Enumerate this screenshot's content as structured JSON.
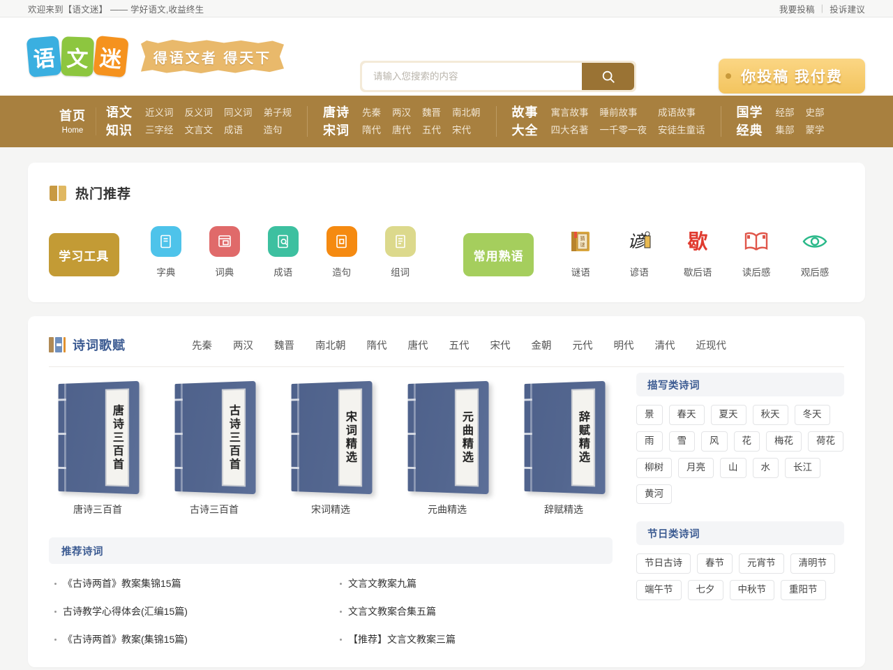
{
  "topbar": {
    "welcome": "欢迎来到【语文迷】 —— 学好语文,收益终生",
    "submit_link": "我要投稿",
    "separator": "|",
    "feedback_link": "投诉建议"
  },
  "header": {
    "logo_chars": [
      "语",
      "文",
      "迷"
    ],
    "slogan": "得语文者 得天下",
    "search": {
      "placeholder": "请输入您搜索的内容",
      "value": "",
      "button_icon": "search-icon"
    },
    "promo": "你投稿 我付费"
  },
  "nav": [
    {
      "title": "首页",
      "sub": "Home",
      "links": [],
      "cols": 1
    },
    {
      "title_l1": "语文",
      "title_l2": "知识",
      "cols": 4,
      "links": [
        "近义词",
        "反义词",
        "同义词",
        "弟子规",
        "三字经",
        "文言文",
        "成语",
        "造句"
      ]
    },
    {
      "title_l1": "唐诗",
      "title_l2": "宋词",
      "cols": 4,
      "links": [
        "先秦",
        "两汉",
        "魏晋",
        "南北朝",
        "隋代",
        "唐代",
        "五代",
        "宋代"
      ]
    },
    {
      "title_l1": "故事",
      "title_l2": "大全",
      "cols": 3,
      "links": [
        "寓言故事",
        "睡前故事",
        "成语故事",
        "四大名著",
        "一千零一夜",
        "安徒生童话"
      ]
    },
    {
      "title_l1": "国学",
      "title_l2": "经典",
      "cols": 2,
      "links": [
        "经部",
        "史部",
        "集部",
        "蒙学"
      ]
    }
  ],
  "hot": {
    "section_title": "热门推荐",
    "section_icon": "open-book-icon",
    "tools_button": "学习工具",
    "tools_color": "#c39b35",
    "idioms_button": "常用熟语",
    "idioms_color": "#a5ce5d",
    "tools_items": [
      {
        "label": "字典",
        "icon": "dictionary-icon",
        "glyph": "字",
        "color": "#4ec3ea"
      },
      {
        "label": "词典",
        "icon": "word-dictionary-icon",
        "glyph": "词",
        "color": "#e06a6a"
      },
      {
        "label": "成语",
        "icon": "idiom-search-icon",
        "glyph": "成",
        "color": "#3dc0a0"
      },
      {
        "label": "造句",
        "icon": "sentence-icon",
        "glyph": "句",
        "color": "#f58a11"
      },
      {
        "label": "组词",
        "icon": "word-group-icon",
        "glyph": "组",
        "color": "#dcd98c"
      }
    ],
    "idiom_items": [
      {
        "label": "谜语",
        "icon": "riddle-book-icon",
        "glyph": "谜",
        "color": "#c9962f"
      },
      {
        "label": "谚语",
        "icon": "proverb-icon",
        "glyph": "谚",
        "color": "#2b2b2b"
      },
      {
        "label": "歇后语",
        "icon": "xiehouyu-icon",
        "glyph": "歇",
        "color": "#e03b2f"
      },
      {
        "label": "读后感",
        "icon": "open-book-red-icon",
        "glyph": "",
        "color": "#e0564a"
      },
      {
        "label": "观后感",
        "icon": "eye-icon",
        "glyph": "",
        "color": "#2bb98a"
      }
    ]
  },
  "poetry": {
    "section_title": "诗词歌赋",
    "section_icon": "books-icon",
    "dynasties": [
      "先秦",
      "两汉",
      "魏晋",
      "南北朝",
      "隋代",
      "唐代",
      "五代",
      "宋代",
      "金朝",
      "元代",
      "明代",
      "清代",
      "近现代"
    ],
    "books": [
      {
        "spine": "唐诗三百首",
        "name": "唐诗三百首"
      },
      {
        "spine": "古诗三百首",
        "name": "古诗三百首"
      },
      {
        "spine": "宋词精选",
        "name": "宋词精选"
      },
      {
        "spine": "元曲精选",
        "name": "元曲精选"
      },
      {
        "spine": "辞赋精选",
        "name": "辞赋精选"
      }
    ],
    "recommend_title": "推荐诗词",
    "recommend_links": [
      "《古诗两首》教案集锦15篇",
      "文言文教案九篇",
      "古诗教学心得体会(汇编15篇)",
      "文言文教案合集五篇",
      "《古诗两首》教案(集锦15篇)",
      "【推荐】文言文教案三篇"
    ]
  },
  "sidebar": {
    "blocks": [
      {
        "title": "描写类诗词",
        "tags": [
          "景",
          "春天",
          "夏天",
          "秋天",
          "冬天",
          "雨",
          "雪",
          "风",
          "花",
          "梅花",
          "荷花",
          "柳树",
          "月亮",
          "山",
          "水",
          "长江",
          "黄河"
        ]
      },
      {
        "title": "节日类诗词",
        "tags": [
          "节日古诗",
          "春节",
          "元宵节",
          "清明节",
          "端午节",
          "七夕",
          "中秋节",
          "重阳节"
        ]
      }
    ]
  },
  "colors": {
    "nav_bg": "#a8803f",
    "page_bg": "#f5f5f4",
    "accent_blue": "#3c5b92",
    "search_btn": "#9a7334"
  }
}
